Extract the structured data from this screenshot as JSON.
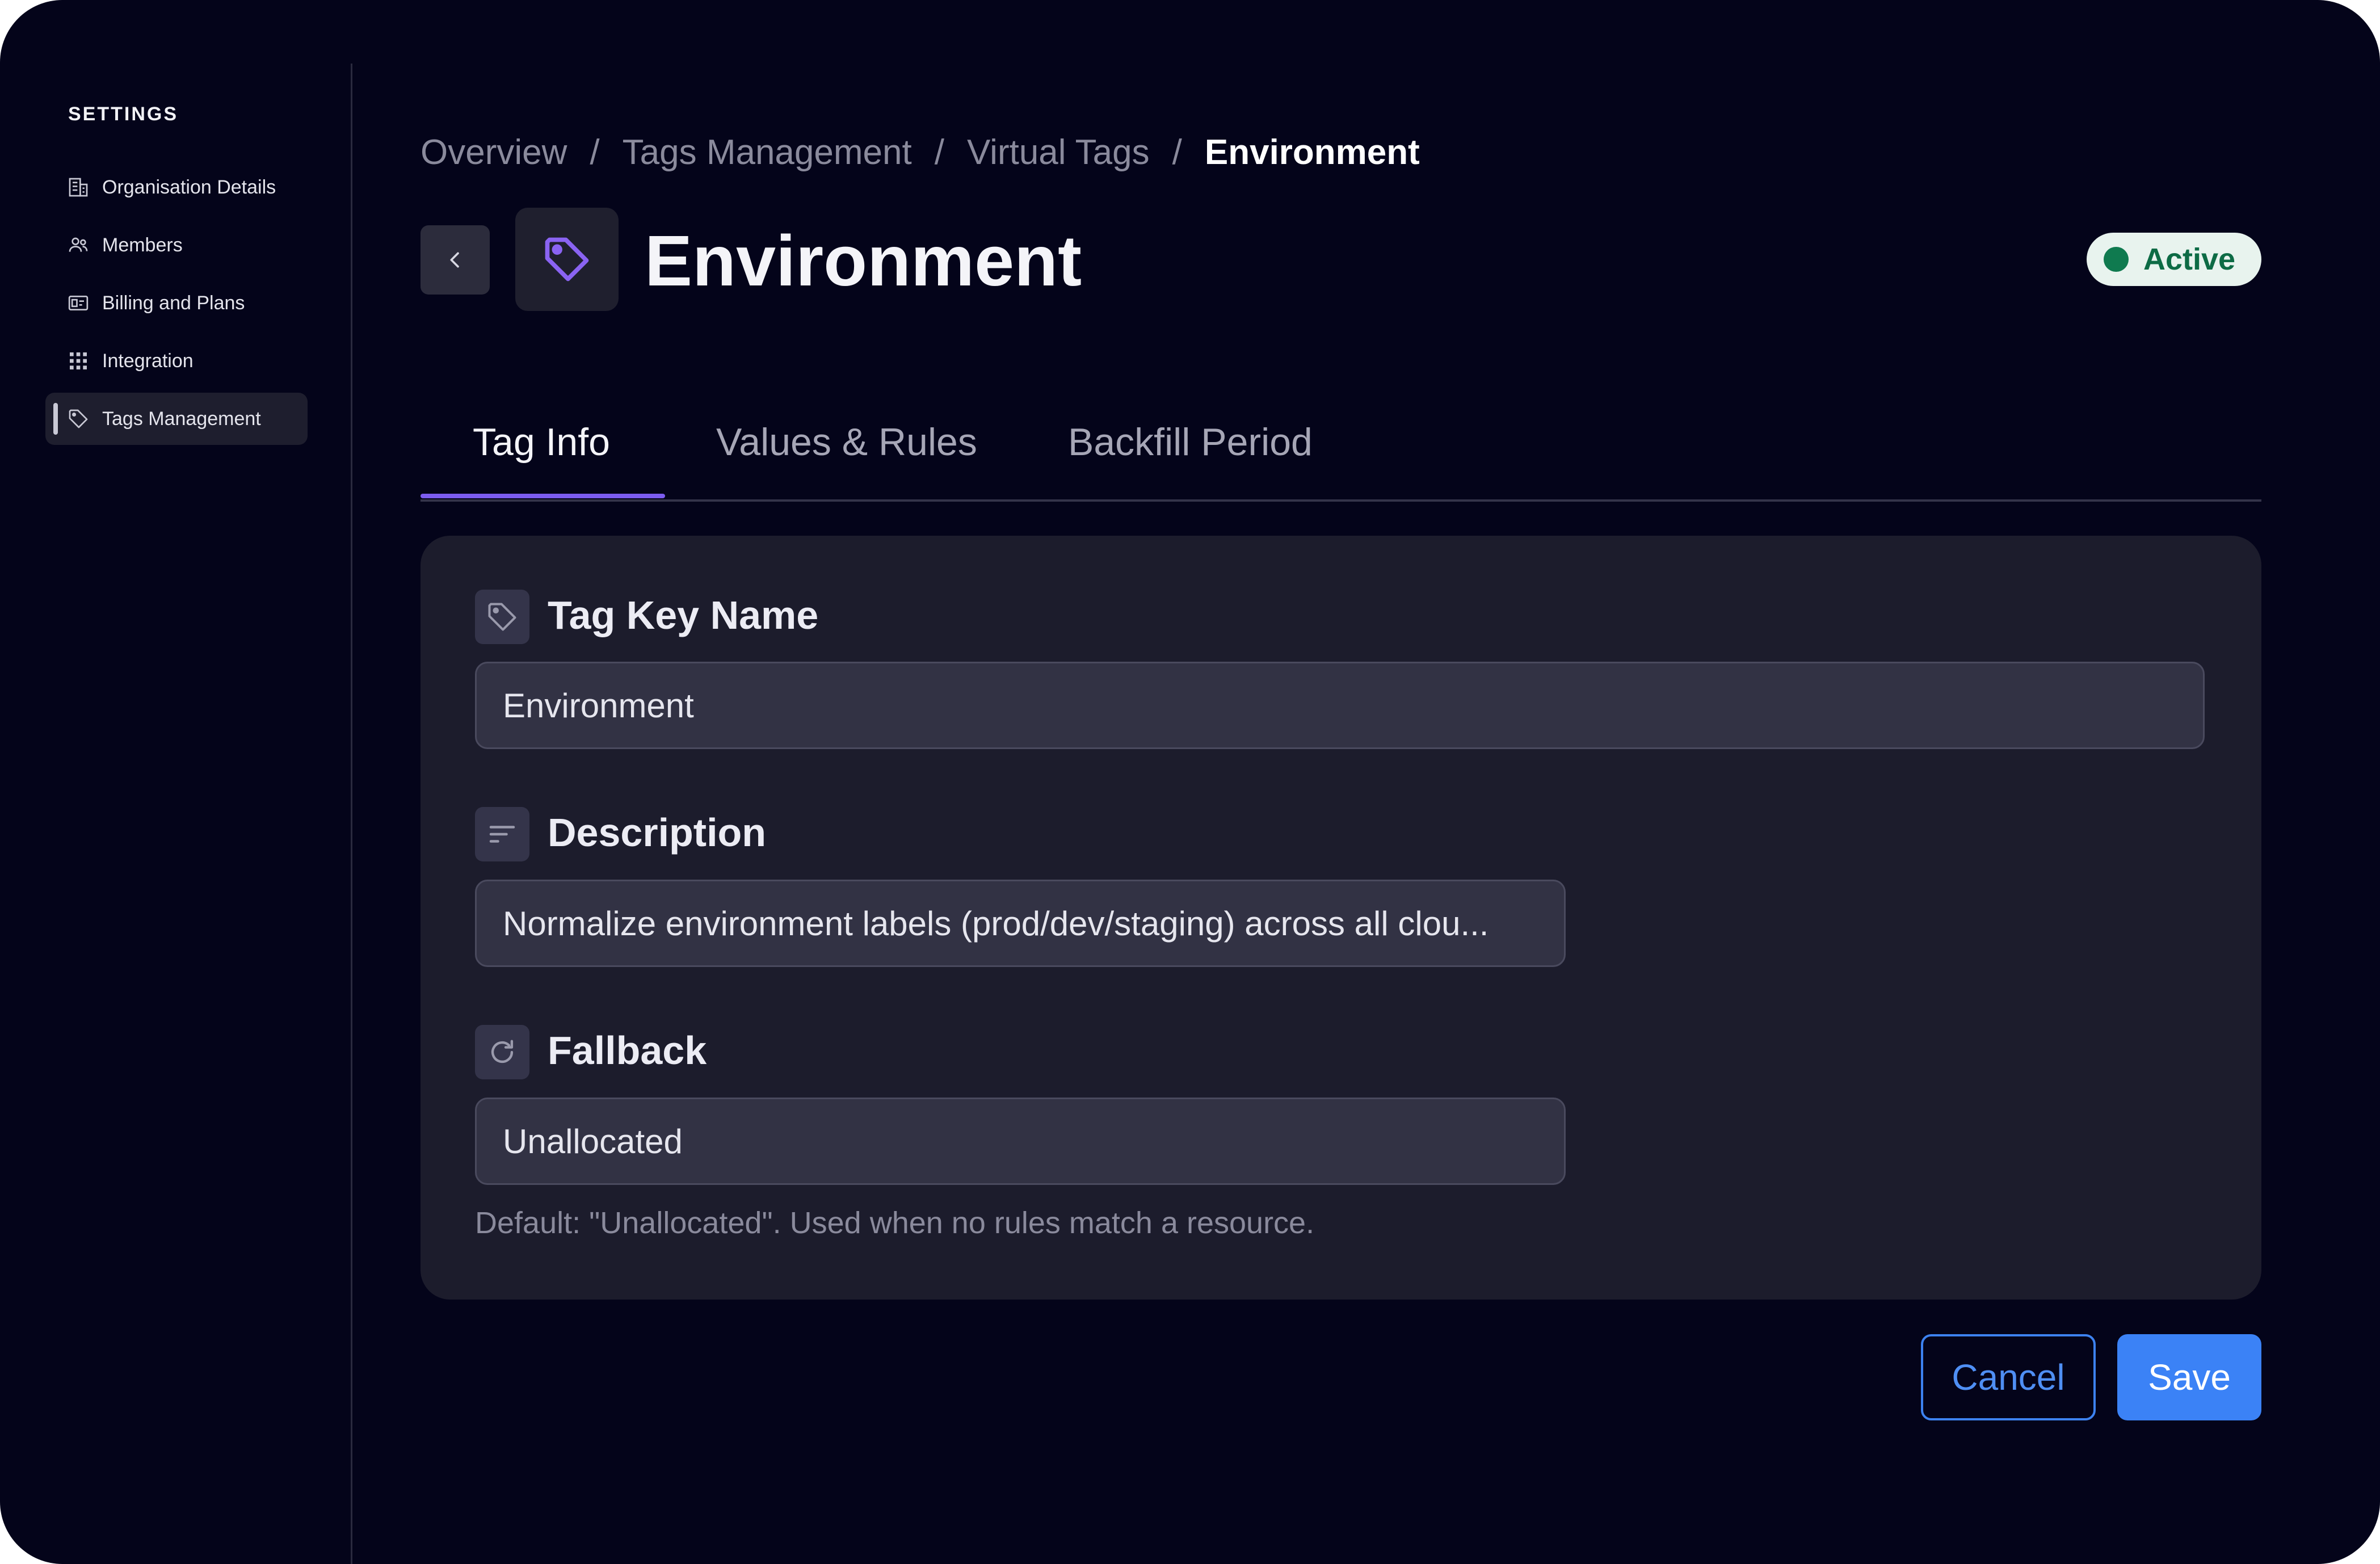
{
  "sidebar": {
    "title": "SETTINGS",
    "items": [
      {
        "label": "Organisation Details",
        "icon": "building-icon"
      },
      {
        "label": "Members",
        "icon": "users-icon"
      },
      {
        "label": "Billing and Plans",
        "icon": "billing-icon"
      },
      {
        "label": "Integration",
        "icon": "grid-icon"
      },
      {
        "label": "Tags Management",
        "icon": "tag-icon",
        "active": true
      }
    ]
  },
  "breadcrumb": {
    "items": [
      "Overview",
      "Tags Management",
      "Virtual Tags",
      "Environment"
    ],
    "separator": "/"
  },
  "header": {
    "title": "Environment",
    "status": "Active",
    "status_color": "#0f7a4f",
    "accent_color": "#7c5cf0"
  },
  "tabs": [
    {
      "label": "Tag Info",
      "active": true
    },
    {
      "label": "Values & Rules"
    },
    {
      "label": "Backfill Period"
    }
  ],
  "form": {
    "tag_key": {
      "label": "Tag Key Name",
      "value": "Environment",
      "icon": "tag-icon"
    },
    "description": {
      "label": "Description",
      "value": "Normalize environment labels (prod/dev/staging) across all clou...",
      "icon": "text-lines-icon"
    },
    "fallback": {
      "label": "Fallback",
      "value": "Unallocated",
      "icon": "refresh-icon",
      "helper": "Default: \"Unallocated\". Used when no rules match a resource."
    }
  },
  "actions": {
    "cancel_label": "Cancel",
    "save_label": "Save",
    "primary_color": "#3b82f6"
  }
}
